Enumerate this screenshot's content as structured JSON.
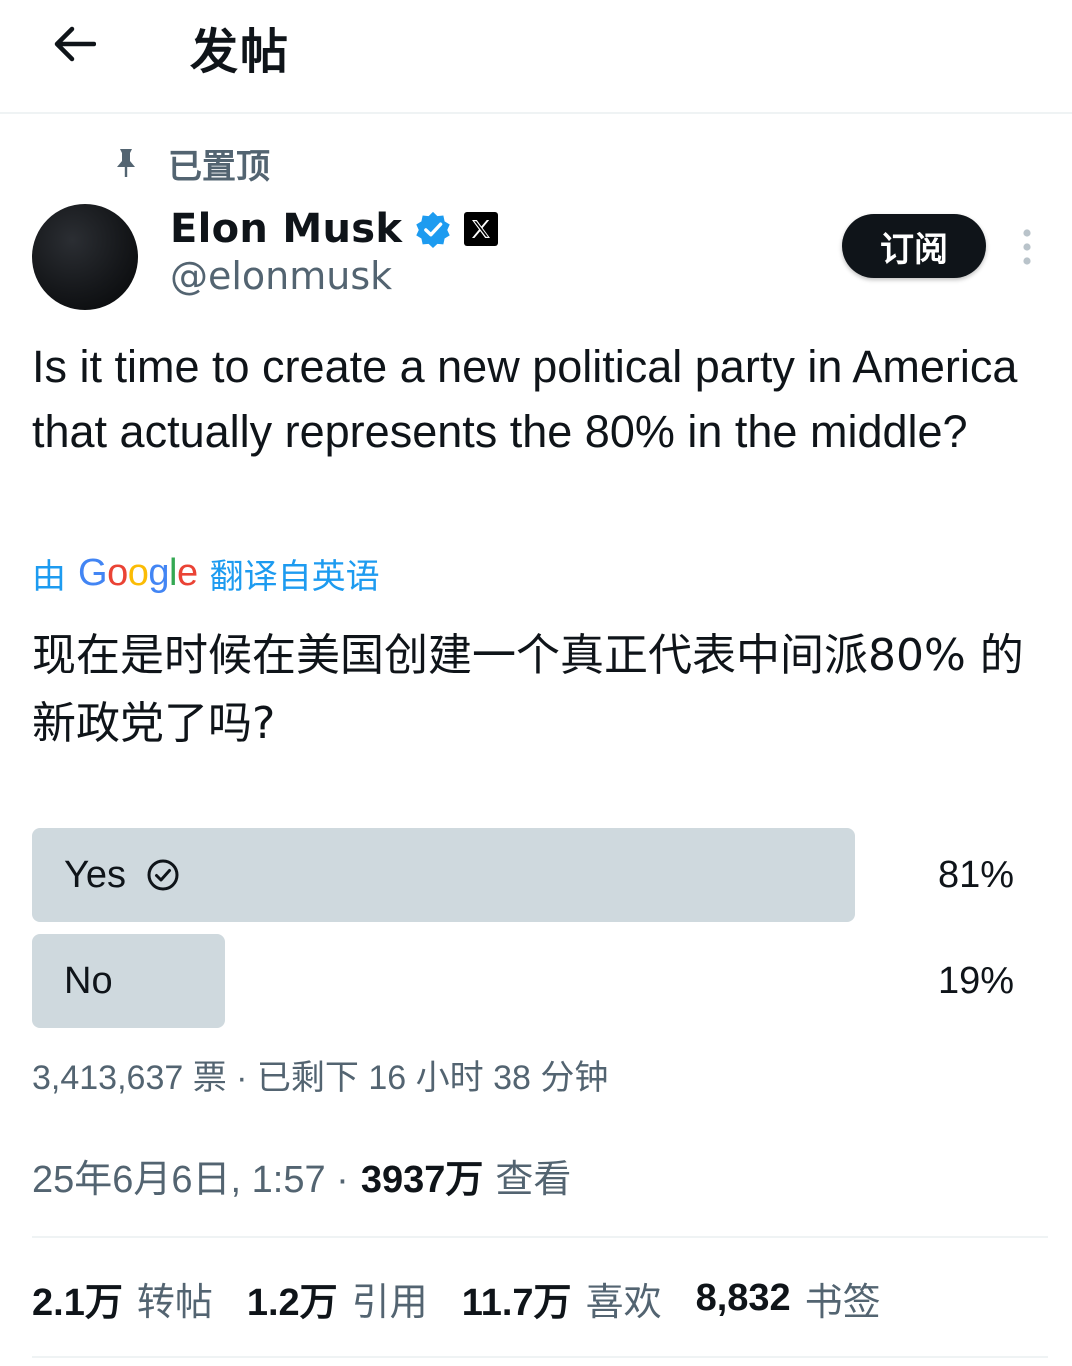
{
  "header": {
    "title": "发帖",
    "back_icon": "arrow-left-icon"
  },
  "pinned": {
    "label": "已置顶",
    "icon": "pin-icon"
  },
  "author": {
    "name": "Elon Musk",
    "handle": "@elonmusk",
    "verified_color": "#1d9bf0",
    "subscribe_label": "订阅"
  },
  "tweet": {
    "text": "Is it time to create a new political party in America that actually represents the 80% in the middle?",
    "translation_prefix": "由",
    "translation_provider": "Google",
    "translation_suffix": "翻译自英语",
    "translated_text": "现在是时候在美国创建一个真正代表中间派80% 的新政党了吗?"
  },
  "poll": {
    "options": [
      {
        "label": "Yes",
        "percent": "81%",
        "fill": 0.823,
        "selected": true
      },
      {
        "label": "No",
        "percent": "19%",
        "fill": 0.193,
        "selected": false
      }
    ],
    "meta": "3,413,637 票 · 已剩下 16 小时 38 分钟"
  },
  "details": {
    "timestamp": "25年6月6日, 1:57 ·",
    "views_count": "3937万",
    "views_label": "查看"
  },
  "stats": {
    "retweets": {
      "count": "2.1万",
      "label": "转帖"
    },
    "quotes": {
      "count": "1.2万",
      "label": "引用"
    },
    "likes": {
      "count": "11.7万",
      "label": "喜欢"
    },
    "bookmarks": {
      "count": "8,832",
      "label": "书签"
    }
  },
  "colors": {
    "accent": "#1d9bf0",
    "secondary_text": "#536471",
    "poll_bar": "#cfd9de"
  }
}
